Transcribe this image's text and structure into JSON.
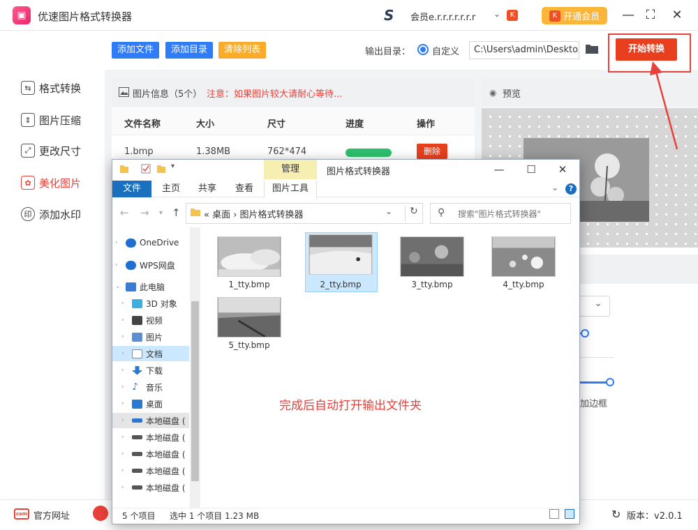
{
  "app": {
    "title": "优速图片格式转换器",
    "logo_icon": "image-app-icon",
    "member_text": "会员​е.r.r.r.r.r.r.r",
    "member_display": "会员e.r.r.r.r.r.r.r",
    "vip_label": "开通会员",
    "vip_badge": "K"
  },
  "sidebar": {
    "items": [
      {
        "label": "格式转换",
        "icon": "format-convert-icon"
      },
      {
        "label": "图片压缩",
        "icon": "compress-icon"
      },
      {
        "label": "更改尺寸",
        "icon": "resize-icon"
      },
      {
        "label": "美化图片",
        "icon": "beautify-icon",
        "active": true
      },
      {
        "label": "添加水印",
        "icon": "watermark-icon"
      }
    ]
  },
  "toolbar": {
    "add_file": "添加文件",
    "add_dir": "添加目录",
    "clear_list": "清除列表",
    "output_label": "输出目录：",
    "custom_label": "自定义",
    "output_path": "C:\\Users\\admin\\Deskto",
    "start_label": "开始转换",
    "colors": {
      "blue": "#2f7cf6",
      "orange": "#fbab2a",
      "red": "#e8401e"
    }
  },
  "file_info": {
    "title": "图片信息（5个）",
    "note": "注意：如果图片较大请耐心等待...",
    "columns": [
      "文件名称",
      "大小",
      "尺寸",
      "进度",
      "操作"
    ],
    "rows": [
      {
        "name": "1.bmp",
        "size": "1.38MB",
        "dims": "762*474",
        "progress": 1.0,
        "action": "删除"
      }
    ]
  },
  "preview": {
    "title": "预览",
    "border_label": "添加边框"
  },
  "status": {
    "site_label": "官方网址",
    "site_icon_text": "com",
    "version": "版本：v2.0.1"
  },
  "explorer": {
    "manage_tab": "管理",
    "title": "图片格式转换器",
    "tabs": [
      "文件",
      "主页",
      "共享",
      "查看",
      "图片工具"
    ],
    "address": "«  桌面  ›  图片格式转换器",
    "search_placeholder": "搜索\"图片格式转换器\"",
    "nav": [
      {
        "label": "OneDrive",
        "icon": "cloud-icon",
        "color": "#1f6fd0",
        "level": 0
      },
      {
        "label": "WPS网盘",
        "icon": "cloud-icon",
        "color": "#1f6fd0",
        "level": 0
      },
      {
        "label": "此电脑",
        "icon": "computer-icon",
        "color": "#3a7bd5",
        "level": 0,
        "expanded": true
      },
      {
        "label": "3D 对象",
        "icon": "cube-icon",
        "color": "#3bb0e0",
        "level": 1
      },
      {
        "label": "视频",
        "icon": "video-icon",
        "color": "#444",
        "level": 1
      },
      {
        "label": "图片",
        "icon": "picture-icon",
        "color": "#5b8fd1",
        "level": 1
      },
      {
        "label": "文档",
        "icon": "document-icon",
        "color": "#7a8ca0",
        "level": 1,
        "selected": true
      },
      {
        "label": "下载",
        "icon": "download-icon",
        "color": "#2a78d2",
        "level": 1
      },
      {
        "label": "音乐",
        "icon": "music-icon",
        "color": "#2a78d2",
        "level": 1
      },
      {
        "label": "桌面",
        "icon": "desktop-icon",
        "color": "#2a78d2",
        "level": 1
      },
      {
        "label": "本地磁盘 (",
        "icon": "drive-icon",
        "color": "#2a78d2",
        "level": 1,
        "highlight": true
      },
      {
        "label": "本地磁盘 (",
        "icon": "drive-icon",
        "color": "#555",
        "level": 1
      },
      {
        "label": "本地磁盘 (",
        "icon": "drive-icon",
        "color": "#555",
        "level": 1
      },
      {
        "label": "本地磁盘 (",
        "icon": "drive-icon",
        "color": "#555",
        "level": 1
      },
      {
        "label": "本地磁盘 (",
        "icon": "drive-icon",
        "color": "#555",
        "level": 1
      }
    ],
    "files": [
      {
        "name": "1_tty.bmp"
      },
      {
        "name": "2_tty.bmp",
        "selected": true
      },
      {
        "name": "3_tty.bmp"
      },
      {
        "name": "4_tty.bmp"
      },
      {
        "name": "5_tty.bmp"
      }
    ],
    "annotation": "完成后自动打开输出文件夹",
    "status_count": "5 个项目",
    "status_selected": "选中 1 个项目  1.23 MB"
  }
}
